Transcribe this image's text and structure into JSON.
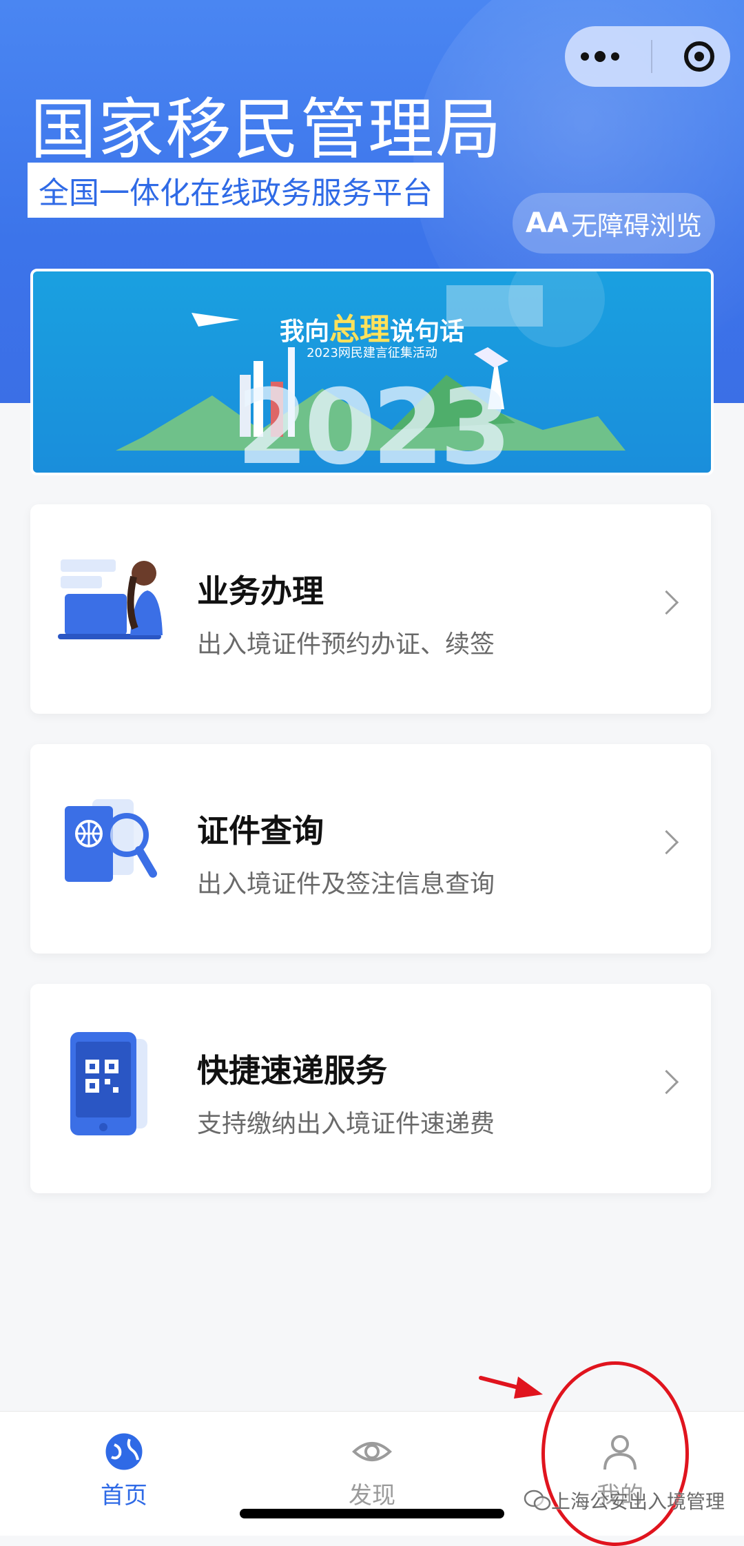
{
  "header": {
    "title": "国家移民管理局",
    "subtitle": "全国一体化在线政务服务平台",
    "accessibility_icon": "AA",
    "accessibility_label": "无障碍浏览"
  },
  "banner": {
    "headline_pre": "我向",
    "headline_big": "总理",
    "headline_post": "说句话",
    "sub": "2023网民建言征集活动",
    "year": "2023"
  },
  "cards": [
    {
      "title": "业务办理",
      "desc": "出入境证件预约办证、续签",
      "icon": "person-laptop-icon"
    },
    {
      "title": "证件查询",
      "desc": "出入境证件及签注信息查询",
      "icon": "passport-search-icon"
    },
    {
      "title": "快捷速递服务",
      "desc": "支持缴纳出入境证件速递费",
      "icon": "phone-qrcode-icon"
    }
  ],
  "tabbar": {
    "items": [
      {
        "label": "首页",
        "active": true,
        "icon": "globe-icon"
      },
      {
        "label": "发现",
        "active": false,
        "icon": "eye-icon"
      },
      {
        "label": "我的",
        "active": false,
        "icon": "person-icon"
      }
    ]
  },
  "colors": {
    "accent": "#2f6ae6",
    "header_bg": "#4a86f2",
    "annotation": "#e0141e"
  },
  "watermark": "上海公安出入境管理"
}
